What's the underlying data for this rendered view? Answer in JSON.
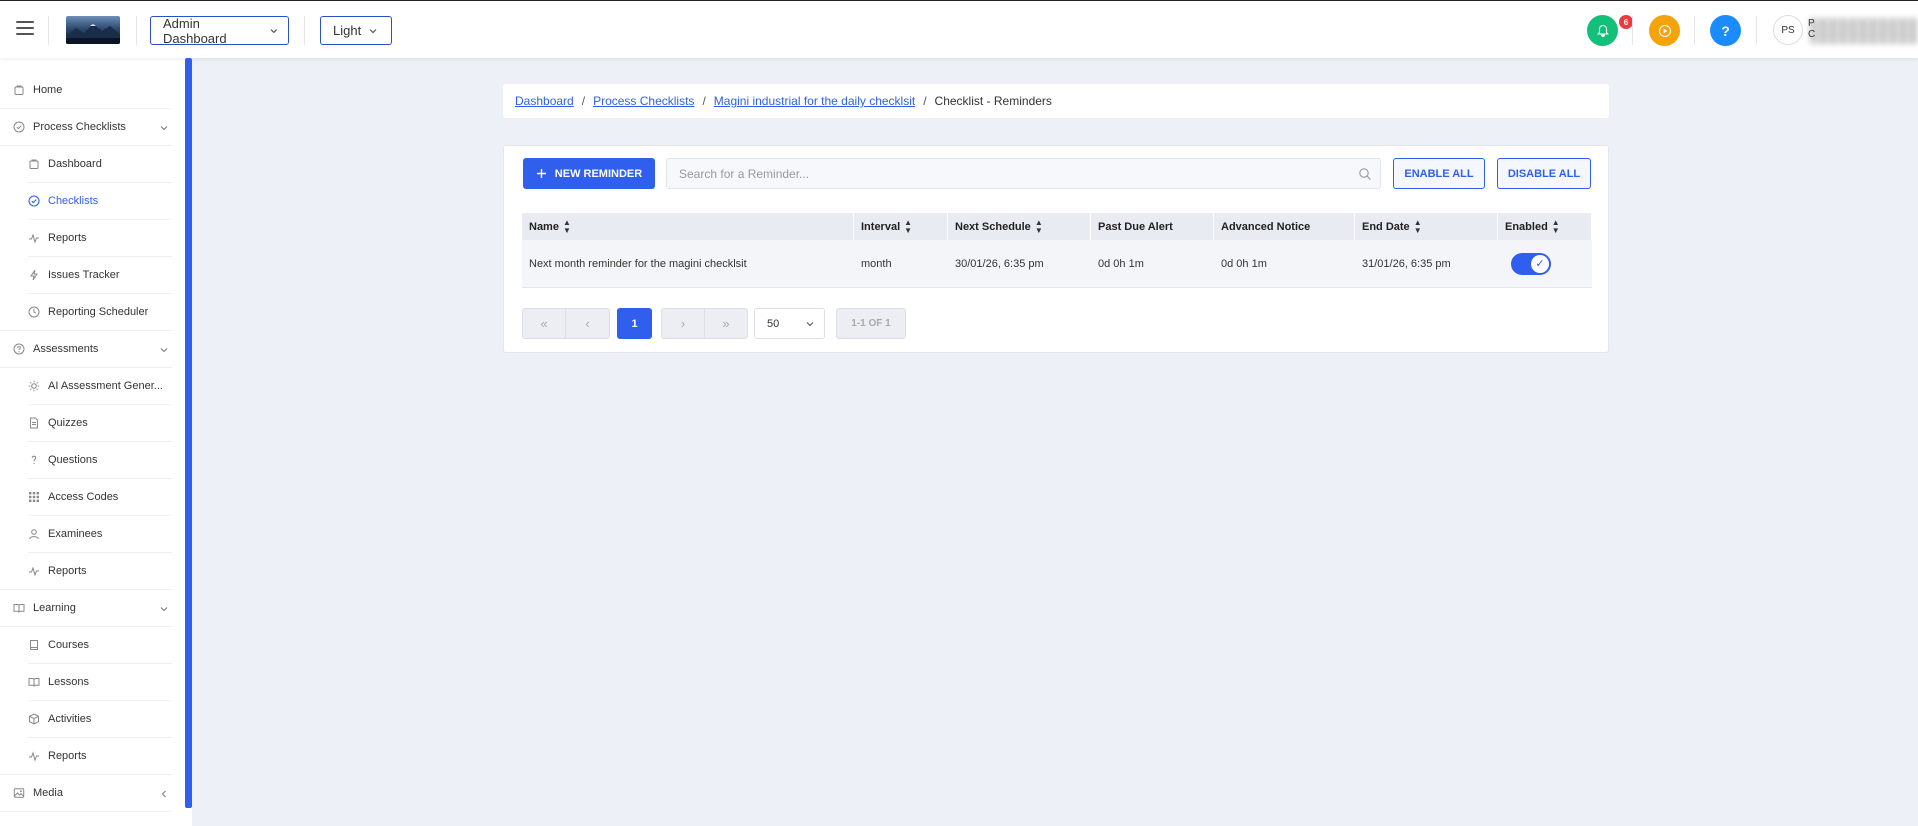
{
  "topbar": {
    "dashboard_select": "Admin Dashboard",
    "theme_select": "Light",
    "notification_count": "6",
    "help_label": "?",
    "user_initials": "PS",
    "user_letter_top": "P",
    "user_letter_bottom": "C"
  },
  "sidebar": {
    "home": "Home",
    "process_checklists": "Process Checklists",
    "pc_dashboard": "Dashboard",
    "pc_checklists": "Checklists",
    "pc_reports": "Reports",
    "pc_issues": "Issues Tracker",
    "pc_scheduler": "Reporting Scheduler",
    "assessments": "Assessments",
    "as_ai": "AI Assessment Gener...",
    "as_quizzes": "Quizzes",
    "as_questions": "Questions",
    "as_access": "Access Codes",
    "as_examinees": "Examinees",
    "as_reports": "Reports",
    "learning": "Learning",
    "le_courses": "Courses",
    "le_lessons": "Lessons",
    "le_activities": "Activities",
    "le_reports": "Reports",
    "media": "Media"
  },
  "breadcrumb": {
    "crumb1": "Dashboard",
    "crumb2": "Process Checklists",
    "crumb3": "Magini industrial for the daily checklsit",
    "current": "Checklist - Reminders",
    "separator": "/"
  },
  "toolbar": {
    "new_label": "NEW REMINDER",
    "search_placeholder": "Search for a Reminder...",
    "enable_all": "ENABLE ALL",
    "disable_all": "DISABLE ALL"
  },
  "table": {
    "headers": {
      "name": "Name",
      "interval": "Interval",
      "next_schedule": "Next Schedule",
      "past_due": "Past Due Alert",
      "advanced": "Advanced Notice",
      "end_date": "End Date",
      "enabled": "Enabled"
    },
    "rows": [
      {
        "name": "Next month reminder for the magini checklsit",
        "interval": "month",
        "next_schedule": "30/01/26, 6:35 pm",
        "past_due": "0d 0h 1m",
        "advanced": "0d 0h 1m",
        "end_date": "31/01/26, 6:35 pm",
        "enabled": true
      }
    ]
  },
  "pager": {
    "first": "«",
    "prev": "‹",
    "current_page": "1",
    "next": "›",
    "last": "»",
    "page_size": "50",
    "info": "1-1 OF 1"
  },
  "colors": {
    "accent": "#2f5fec",
    "bell": "#12c07a",
    "play": "#f5a30a",
    "help": "#1a8cff",
    "badge": "#f0393e"
  }
}
